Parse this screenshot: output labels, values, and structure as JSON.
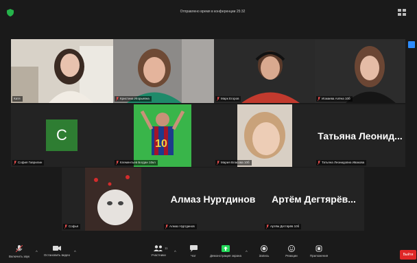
{
  "header": {
    "recording_text": "Отправлено время в конференции 25:32"
  },
  "participants": [
    {
      "name": "Катя"
    },
    {
      "name": "Кристина Игорьевна"
    },
    {
      "name": "Марк Егоров"
    },
    {
      "name": "Исмаева Алёна 10б"
    },
    {
      "name": "София Гаврилин",
      "avatar_letter": "C"
    },
    {
      "name": "Клементьев Богдан 10кл"
    },
    {
      "name": "Мария Власова 10б"
    },
    {
      "name": "Татьяна Леонидовна Ивакова",
      "display": "Татьяна Леонид..."
    },
    {
      "name": "Софья"
    },
    {
      "name": "Алмаз Нуртдинов",
      "display": "Алмаз Нуртдинов"
    },
    {
      "name": "Артём Дегтярёв 10б",
      "display": "Артём Дегтярёв..."
    }
  ],
  "toolbar": {
    "mute": "Включить звук",
    "video": "Остановить видео",
    "participants": "Участники",
    "participants_count": "11",
    "chat": "Чат",
    "share": "Демонстрация экрана",
    "record": "Запись",
    "reactions": "Реакции",
    "apps": "Приложения",
    "end": "Выйти"
  },
  "colors": {
    "active_speaker": "#c9e96a",
    "end_button": "#e02828",
    "share_icon": "#23d959",
    "avatar_bg": "#2e7d32"
  }
}
